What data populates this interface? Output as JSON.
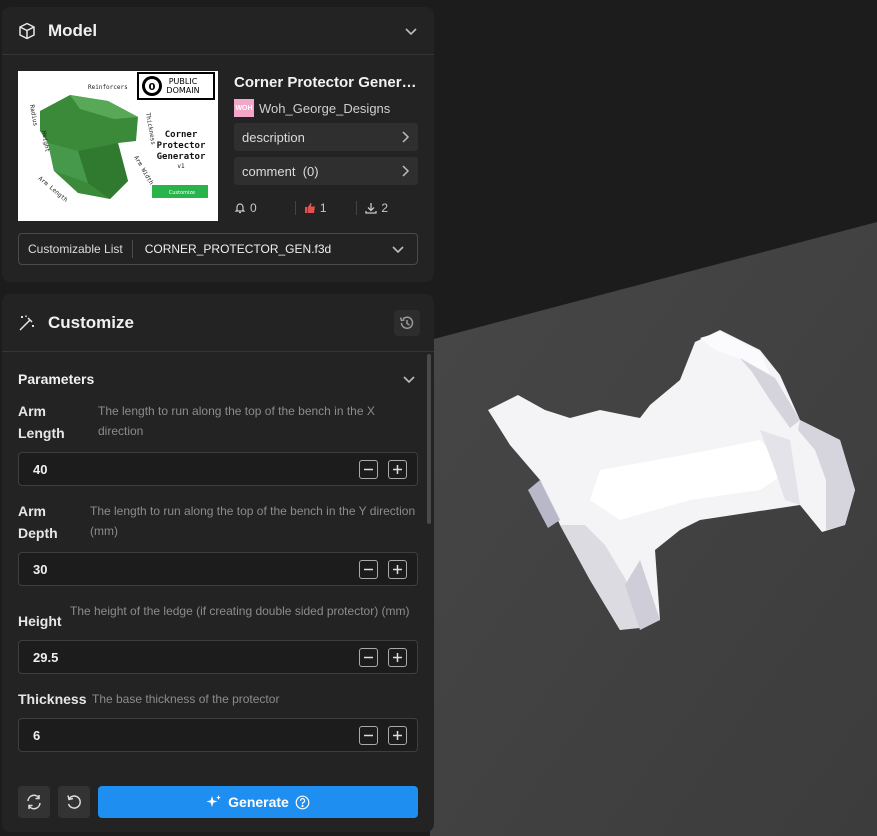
{
  "model_panel": {
    "title": "Model",
    "model_title": "Corner Protector Genera...",
    "author": "Woh_George_Designs",
    "author_avatar_text": "WOH",
    "links": [
      {
        "label": "description",
        "count": ""
      },
      {
        "label": "comment",
        "count": "(0)"
      }
    ],
    "stats": {
      "likes": "0",
      "thumbs": "1",
      "downloads": "2"
    },
    "file_select": {
      "label": "Customizable List",
      "value": "CORNER_PROTECTOR_GEN.f3d"
    },
    "thumbnail": {
      "badge_line1": "PUBLIC",
      "badge_line2": "DOMAIN",
      "badge_symbol": "0",
      "title_line1": "Corner",
      "title_line2": "Protector",
      "title_line3": "Generator",
      "version": "v1",
      "button": "Customize",
      "labels": [
        "Reinforcers",
        "Thickness",
        "Radius",
        "Height",
        "Arm Length",
        "Arm Width"
      ]
    }
  },
  "customize_panel": {
    "title": "Customize",
    "section_title": "Parameters",
    "params": [
      {
        "name_line1": "Arm",
        "name_line2": "Length",
        "desc": "The length to run along the top of the bench in the X direction",
        "value": "40"
      },
      {
        "name_line1": "Arm",
        "name_line2": "Depth",
        "desc": "The length to run along the top of the bench in the Y direction (mm)",
        "value": "30"
      },
      {
        "name_line1": "Height",
        "name_line2": "",
        "desc": "The height of the ledge (if creating double sided protector) (mm)",
        "value": "29.5"
      },
      {
        "name_line1": "Thickness",
        "name_line2": "",
        "desc": "The base thickness of the protector",
        "value": "6"
      }
    ],
    "generate_label": "Generate"
  },
  "colors": {
    "accent": "#1f8ef1",
    "model_green": "#3a8a3a",
    "thumb_red": "#e0524f"
  }
}
